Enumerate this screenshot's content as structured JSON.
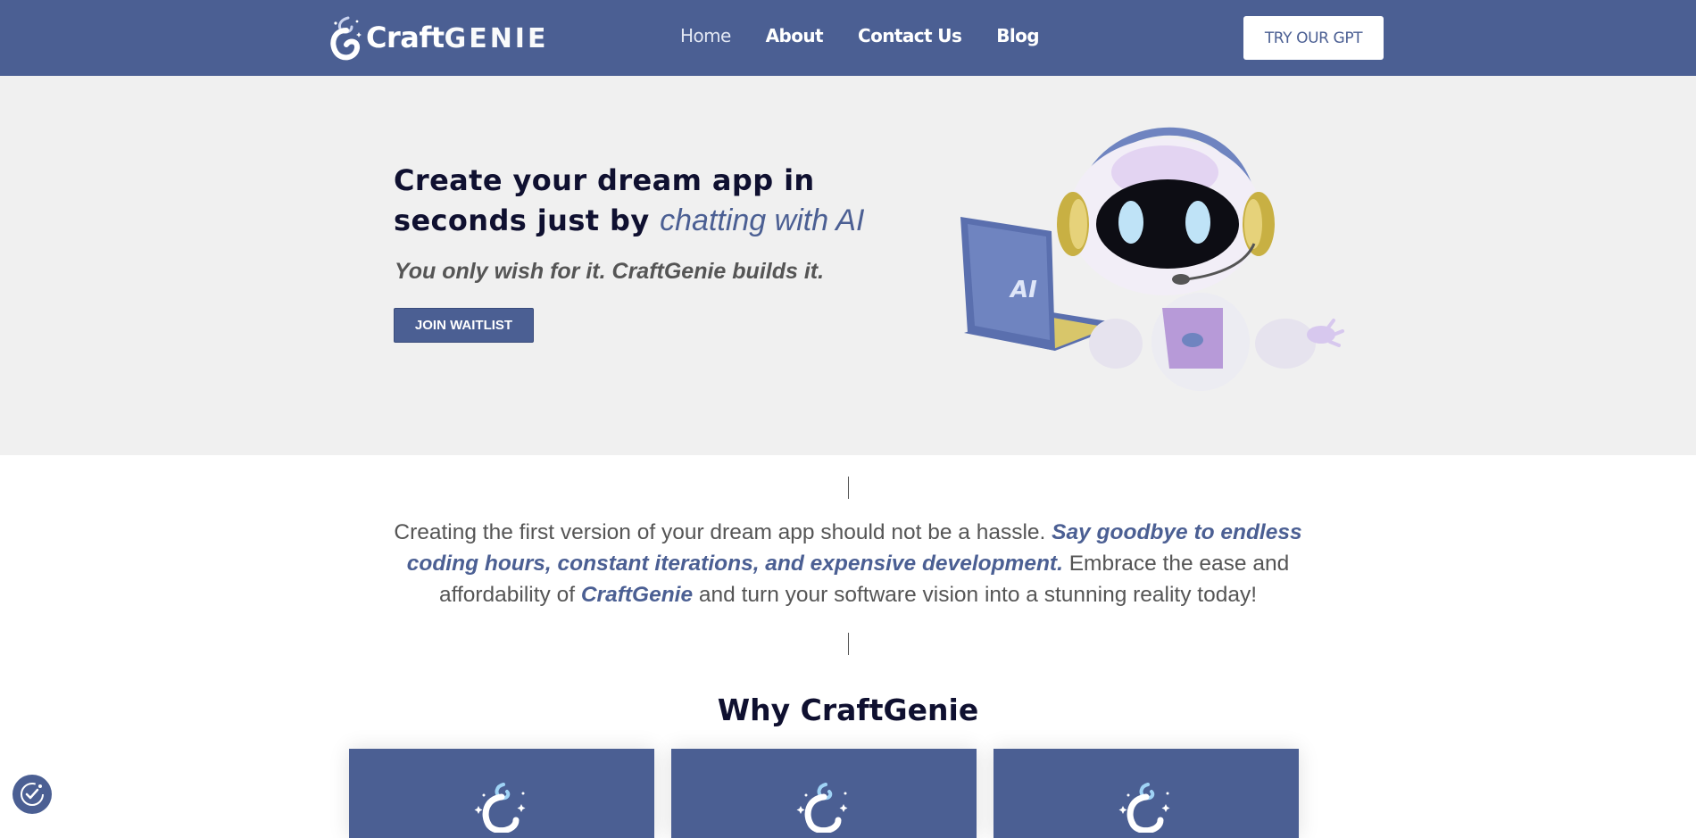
{
  "brand": {
    "name_part1": "Craft",
    "name_part2": "Genie"
  },
  "nav": {
    "items": [
      {
        "label": "Home"
      },
      {
        "label": "About"
      },
      {
        "label": "Contact Us"
      },
      {
        "label": "Blog"
      }
    ],
    "cta_label": "TRY OUR GPT"
  },
  "hero": {
    "title_part1": "Create your dream app in seconds just by ",
    "title_accent": "chatting with AI",
    "subtitle": "You only wish for it. CraftGenie builds it.",
    "button_label": "JOIN WAITLIST",
    "laptop_text": "AI"
  },
  "intro": {
    "text1": "Creating the first version of your dream app should not be a hassle. ",
    "emphasis1": "Say goodbye to endless coding hours, constant iterations, and expensive development.",
    "text2": " Embrace the ease and affordability of ",
    "emphasis2": "CraftGenie",
    "text3": " and turn your software vision into a stunning reality today!"
  },
  "why": {
    "title": "Why CraftGenie"
  },
  "icons": {
    "logo": "genie-lamp-logo-icon",
    "card": "genie-swirl-icon",
    "accessibility": "accessibility-check-icon"
  },
  "colors": {
    "primary": "#4b5f93",
    "hero_bg": "#f0f0f0",
    "heading": "#0f1030",
    "body_text": "#555555"
  }
}
